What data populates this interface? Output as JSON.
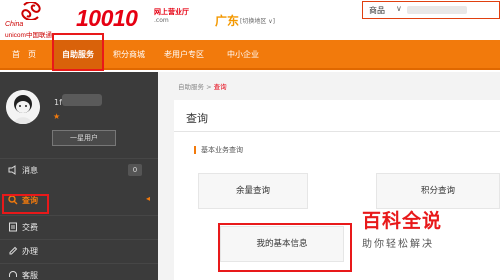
{
  "header": {
    "logo_line1": "China",
    "logo_line2": "unicom中国联通",
    "brand_number": "10010",
    "brand_cn": "网上营业厅",
    "brand_sub": ".com",
    "province": "广东",
    "switch_region": "[切换地区 ∨]",
    "search_category": "商品",
    "search_chevron": "∨"
  },
  "nav": {
    "items": [
      {
        "label": "首　页"
      },
      {
        "label": "自助服务"
      },
      {
        "label": "积分商城"
      },
      {
        "label": "老用户专区"
      },
      {
        "label": "中小企业"
      }
    ],
    "active_index": 1
  },
  "sidebar": {
    "user_prefix": "1f",
    "star": "★",
    "level_button": "一星用户",
    "items": [
      {
        "label": "消息",
        "count": "0"
      },
      {
        "label": "查询",
        "arrow": "◂"
      },
      {
        "label": "交费"
      },
      {
        "label": "办理"
      },
      {
        "label": "客服"
      }
    ]
  },
  "main": {
    "breadcrumb_root": "自助服务",
    "breadcrumb_sep": " > ",
    "breadcrumb_current": "查询",
    "panel_title": "查询",
    "section_title": "基本业务查询",
    "buttons": [
      {
        "label": "余量查询"
      },
      {
        "label": "积分查询"
      },
      {
        "label": "我的基本信息"
      }
    ]
  },
  "watermark": {
    "big": "百科全说",
    "small": "助你轻松解决"
  },
  "colors": {
    "brand_red": "#e60012",
    "nav_orange": "#f27a0c",
    "sidebar_dark": "#3b3b3b",
    "highlight_red": "#e8191a"
  }
}
